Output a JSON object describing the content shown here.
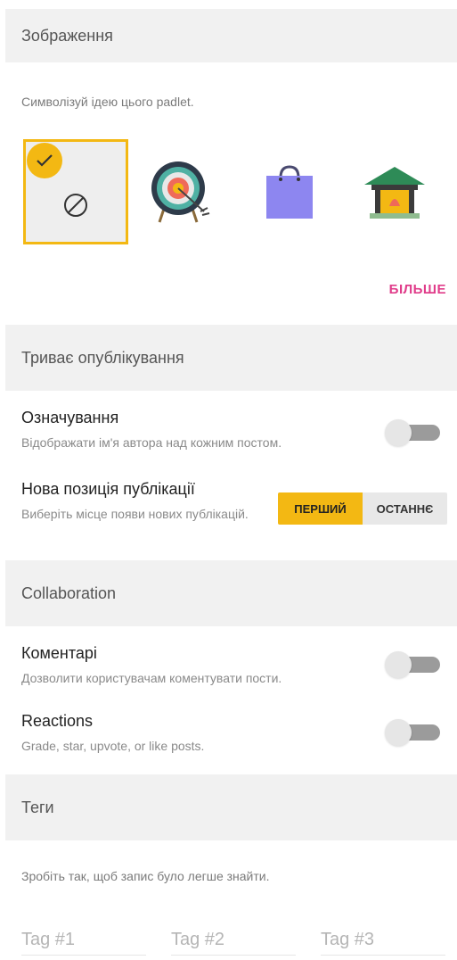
{
  "image_section": {
    "header": "Зображення",
    "hint": "Символізуй ідею цього padlet.",
    "options": [
      "none-icon",
      "target-icon",
      "shopping-bag-icon",
      "temple-icon"
    ],
    "more_label": "БІЛЬШЕ"
  },
  "posting_section": {
    "header": "Триває опублікування",
    "attribution": {
      "title": "Означування",
      "subtitle": "Відображати ім'я автора над кожним постом.",
      "enabled": false
    },
    "new_post_position": {
      "title": "Нова позиція публікації",
      "subtitle": "Виберіть місце появи нових публікацій.",
      "first_label": "ПЕРШИЙ",
      "last_label": "ОСТАННЄ",
      "selected": "first"
    }
  },
  "collaboration_section": {
    "header": "Collaboration",
    "comments": {
      "title": "Коментарі",
      "subtitle": "Дозволити користувачам коментувати пости.",
      "enabled": false
    },
    "reactions": {
      "title": "Reactions",
      "subtitle": "Grade, star, upvote, or like posts.",
      "enabled": false
    }
  },
  "tags_section": {
    "header": "Теги",
    "hint": "Зробіть так, щоб запис було легше знайти.",
    "placeholders": [
      "Tag #1",
      "Tag #2",
      "Tag #3"
    ]
  },
  "colors": {
    "accent": "#f3b813",
    "link": "#e03c8a",
    "header_bg": "#f1f1f1"
  }
}
